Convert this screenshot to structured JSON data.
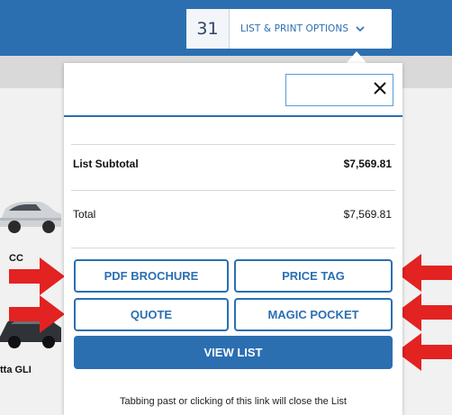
{
  "toolbar": {
    "count": "31",
    "options_label": "LIST & PRINT OPTIONS",
    "chevron_icon": "chevron-down-icon"
  },
  "background": {
    "car_labels": [
      "CC",
      "tta GLI"
    ]
  },
  "panel": {
    "close_icon": "close-icon",
    "list_subtotal_label": "List Subtotal",
    "list_subtotal_value": "$7,569.81",
    "total_label": "Total",
    "total_value": "$7,569.81",
    "buttons": {
      "pdf_brochure": "PDF BROCHURE",
      "price_tag": "PRICE TAG",
      "quote": "QUOTE",
      "magic_pocket": "MAGIC POCKET",
      "view_list": "VIEW LIST"
    },
    "note": "Tabbing past or clicking of this link will close the List"
  },
  "colors": {
    "brand_blue": "#2b6fb1",
    "arrow_red": "#e32222"
  }
}
